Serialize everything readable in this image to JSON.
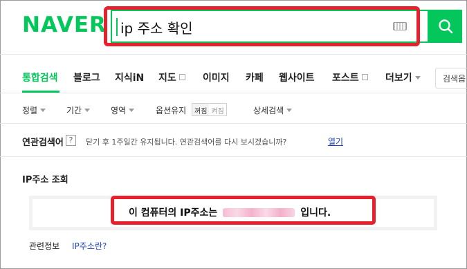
{
  "header": {
    "logo": "NAVER",
    "search_value": "ip 주소 확인"
  },
  "tabs": [
    {
      "label": "통합검색",
      "active": true
    },
    {
      "label": "블로그"
    },
    {
      "label": "지식iN"
    },
    {
      "label": "지도"
    },
    {
      "label": "이미지"
    },
    {
      "label": "카페"
    },
    {
      "label": "웹사이트"
    },
    {
      "label": "포스트"
    },
    {
      "label": "더보기"
    }
  ],
  "search_option_label": "검색옵",
  "filters": {
    "sort": "정렬",
    "period": "기간",
    "area": "영역",
    "option_keep": "옵션유지",
    "toggle_on": "꺼짐",
    "toggle_off": "켜짐",
    "detail": "상세검색"
  },
  "related": {
    "label": "연관검색어",
    "help": "?",
    "message": "닫기 후 1주일간 유지됩니다. 연관검색어를 다시 보시겠습니까?",
    "open_link": "열기"
  },
  "ip_lookup": {
    "title": "IP주소 조회",
    "prefix": "이 컴퓨터의 IP주소는",
    "suffix": "입니다."
  },
  "info": {
    "label": "관련정보",
    "link": "IP주소란?"
  },
  "colors": {
    "brand_green": "#03c75a",
    "highlight_red": "#e8202e",
    "link_blue": "#1f46c1"
  }
}
